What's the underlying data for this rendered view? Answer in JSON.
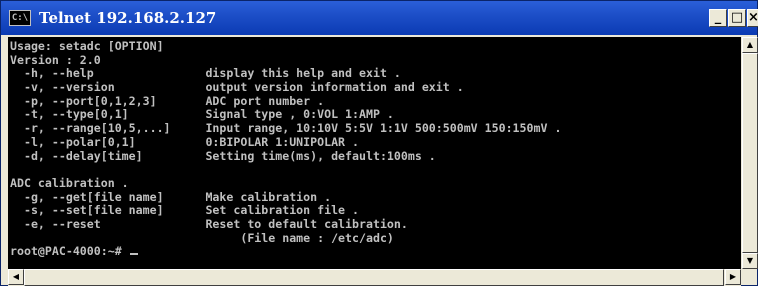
{
  "window": {
    "icon_label": "C:\\",
    "title": "Telnet 192.168.2.127",
    "controls": {
      "minimize": "_",
      "maximize": "□",
      "close": "×"
    }
  },
  "console": {
    "lines": [
      "Usage: setadc [OPTION]",
      "Version : 2.0",
      "  -h, --help                display this help and exit .",
      "  -v, --version             output version information and exit .",
      "  -p, --port[0,1,2,3]       ADC port number .",
      "  -t, --type[0,1]           Signal type , 0:VOL 1:AMP .",
      "  -r, --range[10,5,...]     Input range, 10:10V 5:5V 1:1V 500:500mV 150:150mV .",
      "  -l, --polar[0,1]          0:BIPOLAR 1:UNIPOLAR .",
      "  -d, --delay[time]         Setting time(ms), default:100ms .",
      "",
      "ADC calibration .",
      "  -g, --get[file name]      Make calibration .",
      "  -s, --set[file name]      Set calibration file .",
      "  -e, --reset               Reset to default calibration.",
      "                                 (File name : /etc/adc)",
      "root@PAC-4000:~# "
    ]
  },
  "scrollbars": {
    "up_arrow": "▲",
    "down_arrow": "▼",
    "left_arrow": "◀",
    "right_arrow": "▶"
  }
}
